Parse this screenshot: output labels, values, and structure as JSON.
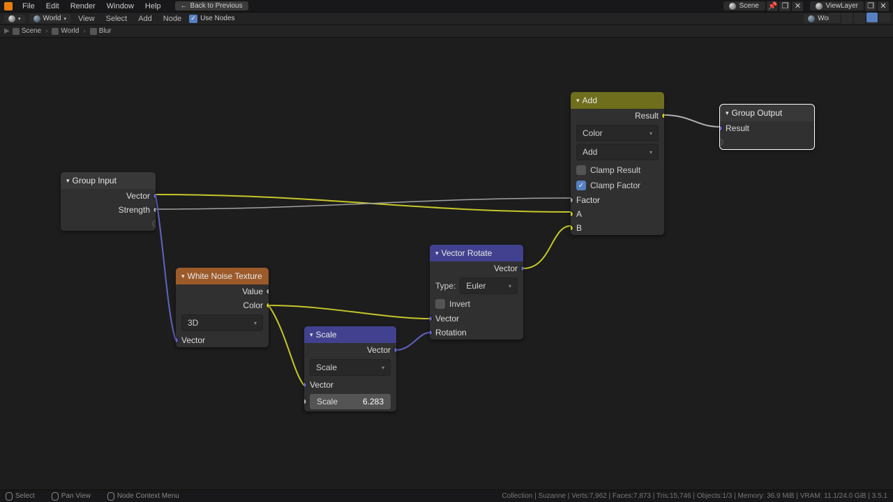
{
  "topmenu": {
    "items": [
      "File",
      "Edit",
      "Render",
      "Window",
      "Help"
    ],
    "back": "Back to Previous",
    "scene": "Scene",
    "viewlayer": "ViewLayer"
  },
  "header": {
    "datablock": "World",
    "world": "World",
    "menus": [
      "View",
      "Select",
      "Add",
      "Node"
    ],
    "use_nodes": "Use Nodes"
  },
  "breadcrumb": {
    "scene": "Scene",
    "world": "World",
    "group": "Blur"
  },
  "nodes": {
    "group_input": {
      "title": "Group Input",
      "out0": "Vector",
      "out1": "Strength"
    },
    "group_output": {
      "title": "Group Output",
      "in0": "Result"
    },
    "add": {
      "title": "Add",
      "out0": "Result",
      "mode": "Color",
      "op": "Add",
      "clamp_result": "Clamp Result",
      "clamp_factor": "Clamp Factor",
      "in_factor": "Factor",
      "in_a": "A",
      "in_b": "B"
    },
    "noise": {
      "title": "White Noise Texture",
      "out_value": "Value",
      "out_color": "Color",
      "dim": "3D",
      "in_vector": "Vector"
    },
    "scale": {
      "title": "Scale",
      "out_vec": "Vector",
      "op": "Scale",
      "in_vector": "Vector",
      "in_scale_lbl": "Scale",
      "in_scale_val": "6.283"
    },
    "rotate": {
      "title": "Vector Rotate",
      "out_vec": "Vector",
      "type_lbl": "Type:",
      "type_val": "Euler",
      "invert": "Invert",
      "in_vector": "Vector",
      "in_rotation": "Rotation"
    }
  },
  "footer": {
    "select": "Select",
    "pan": "Pan View",
    "ctx": "Node Context Menu",
    "stats": "Collection | Suzanne | Verts:7,962 | Faces:7,873 | Tris:15,746 | Objects:1/3 | Memory: 36.9 MiB | VRAM: 11.1/24.0 GiB | 3.5.1"
  }
}
